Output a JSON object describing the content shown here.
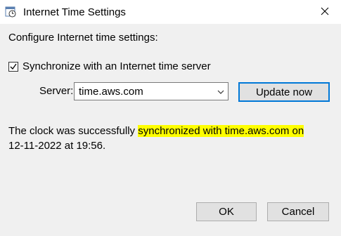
{
  "window": {
    "title": "Internet Time Settings",
    "icon": "clock-settings-icon",
    "close_icon": "close-icon"
  },
  "main": {
    "configure_label": "Configure Internet time settings:",
    "sync_checkbox": {
      "label": "Synchronize with an Internet time server",
      "checked": true
    },
    "server_label": "Server:",
    "server_value": "time.aws.com",
    "update_button": "Update now",
    "status_text_before": "The clock was successfully ",
    "status_text_highlight": "synchronized with time.aws.com on",
    "status_text_after": "12-11-2022 at 19:56.",
    "highlight_color": "#ffff00"
  },
  "footer": {
    "ok_label": "OK",
    "cancel_label": "Cancel"
  },
  "colors": {
    "accent": "#0078d7",
    "background": "#f0f0f0"
  }
}
